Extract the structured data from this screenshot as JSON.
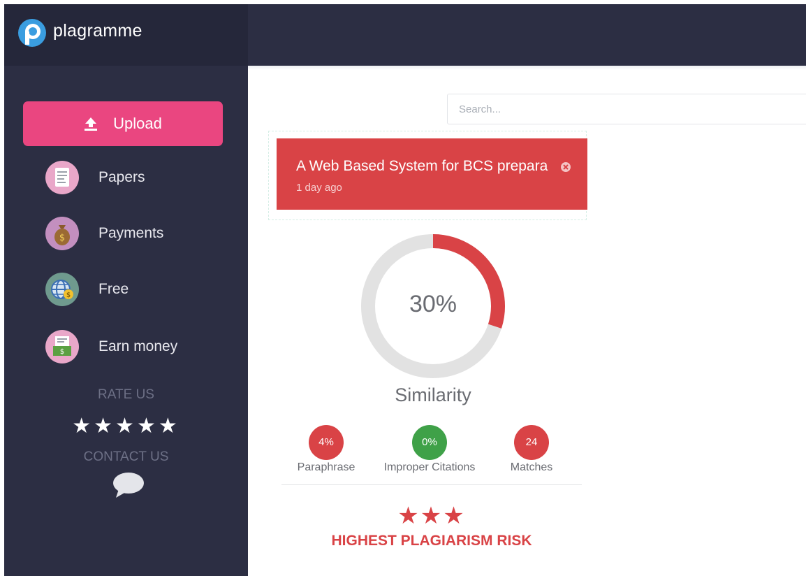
{
  "app": {
    "name": "plagramme"
  },
  "sidebar": {
    "upload_label": "Upload",
    "items": [
      {
        "label": "Papers",
        "icon": "document-icon",
        "color": "#e9a7c9"
      },
      {
        "label": "Payments",
        "icon": "money-bag-icon",
        "color": "#c38fbf"
      },
      {
        "label": "Free",
        "icon": "globe-dollar-icon",
        "color": "#6f9a8e"
      },
      {
        "label": "Earn money",
        "icon": "cash-register-icon",
        "color": "#e9a7c9"
      }
    ],
    "rate_label": "RATE US",
    "rating_stars": 5,
    "contact_label": "CONTACT US"
  },
  "search": {
    "placeholder": "Search..."
  },
  "document": {
    "title": "A Web Based System for BCS prepara",
    "time": "1 day ago"
  },
  "similarity": {
    "value_text": "30%",
    "value": 30,
    "label": "Similarity"
  },
  "metrics": [
    {
      "value": "4%",
      "label": "Paraphrase",
      "color": "#d94346"
    },
    {
      "value": "0%",
      "label": "Improper Citations",
      "color": "#3fa148"
    },
    {
      "value": "24",
      "label": "Matches",
      "color": "#d94346"
    }
  ],
  "risk": {
    "stars": 3,
    "label": "HIGHEST PLAGIARISM RISK"
  },
  "colors": {
    "sidebar_bg": "#2c2e43",
    "accent_pink": "#ea4680",
    "danger_red": "#d94346",
    "success_green": "#3fa148"
  }
}
